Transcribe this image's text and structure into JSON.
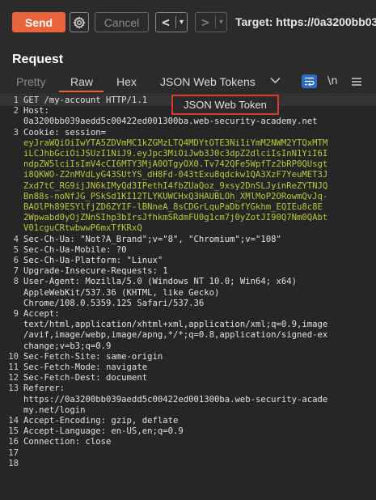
{
  "toolbar": {
    "send_label": "Send",
    "cancel_label": "Cancel",
    "back_arrow": "<",
    "forward_arrow": ">",
    "dropdown_arrow": "▾",
    "target_label": "Target: https://0a3200bb03"
  },
  "request": {
    "title": "Request",
    "tabs": [
      {
        "label": "Pretty"
      },
      {
        "label": "Raw"
      },
      {
        "label": "Hex"
      },
      {
        "label": "JSON Web Tokens"
      }
    ],
    "newline_icon_text": "\\n",
    "tooltip": "JSON Web Token"
  },
  "editor": {
    "lines": [
      {
        "n": "1",
        "text": "GET /my-account HTTP/1.1"
      },
      {
        "n": "2",
        "text": "Host:"
      },
      {
        "n": "",
        "text": "0a3200bb039aedd5c00422ed001300ba.web-security-academy.net"
      },
      {
        "n": "3",
        "text": "Cookie: session="
      },
      {
        "n": "",
        "text": "eyJraWQiOiIwYTA5ZDVmMC1kZGMzLTQ4MDYtOTE3Ni1iYmM2NWM2YTQxMTM",
        "cookie": true
      },
      {
        "n": "",
        "text": "iLCJhbGciOiJSUzI1NiJ9.eyJpc3MiOiJwb3J0c3dpZ2dlciIsInN1YiI6I",
        "cookie": true
      },
      {
        "n": "",
        "text": "ndpZW5lciIsImV4cCI6MTY3MjA0OTgyOX0.Tv742QFe5WpfTz2bRP0QUsgt",
        "cookie": true
      },
      {
        "n": "",
        "text": "i8QKWO-Z2nMVdLyG43SUtYS_dH8Fd-043tExu8qdckw1QA3XzF7YeuMET3J",
        "cookie": true
      },
      {
        "n": "",
        "text": "Zxd7tC_RG9ijJN6kIMyQd3IPethI4fbZUaQoz_9xsy2DnSLJyinReZYTNJQ",
        "cookie": true
      },
      {
        "n": "",
        "text": "Bn88s-noNfJG_PSkSd1KI12TLYKUWCHxQ3HAUBLOh_XMlMoP2ORowmQvJq-",
        "cookie": true
      },
      {
        "n": "",
        "text": "BAOlPh89ESYlfjZD6ZYIF-lBNneA_8sCDGrLquPaDbfYGkhm_EQIEu8c8E",
        "cookie": true
      },
      {
        "n": "",
        "text": "2Wpwabd0yOjZNnSIhp3bIrsJfhkmSRdmFU0g1cm7j0yZotJI90Q7Nm0QAbt",
        "cookie": true
      },
      {
        "n": "",
        "text": "V01cguCRtwbwwP6mxTfKRxQ",
        "cookie": true
      },
      {
        "n": "4",
        "text": "Sec-Ch-Ua: \"Not?A_Brand\";v=\"8\", \"Chromium\";v=\"108\""
      },
      {
        "n": "5",
        "text": "Sec-Ch-Ua-Mobile: ?0"
      },
      {
        "n": "6",
        "text": "Sec-Ch-Ua-Platform: \"Linux\""
      },
      {
        "n": "7",
        "text": "Upgrade-Insecure-Requests: 1"
      },
      {
        "n": "8",
        "text": "User-Agent: Mozilla/5.0 (Windows NT 10.0; Win64; x64)"
      },
      {
        "n": "",
        "text": "AppleWebKit/537.36 (KHTML, like Gecko)"
      },
      {
        "n": "",
        "text": "Chrome/108.0.5359.125 Safari/537.36"
      },
      {
        "n": "9",
        "text": "Accept:"
      },
      {
        "n": "",
        "text": "text/html,application/xhtml+xml,application/xml;q=0.9,image"
      },
      {
        "n": "",
        "text": "/avif,image/webp,image/apng,*/*;q=0.8,application/signed-ex"
      },
      {
        "n": "",
        "text": "change;v=b3;q=0.9"
      },
      {
        "n": "10",
        "text": "Sec-Fetch-Site: same-origin"
      },
      {
        "n": "11",
        "text": "Sec-Fetch-Mode: navigate"
      },
      {
        "n": "12",
        "text": "Sec-Fetch-Dest: document"
      },
      {
        "n": "13",
        "text": "Referer:"
      },
      {
        "n": "",
        "text": "https://0a3200bb039aedd5c00422ed001300ba.web-security-acade"
      },
      {
        "n": "",
        "text": "my.net/login"
      },
      {
        "n": "14",
        "text": "Accept-Encoding: gzip, deflate"
      },
      {
        "n": "15",
        "text": "Accept-Language: en-US,en;q=0.9"
      },
      {
        "n": "16",
        "text": "Connection: close"
      },
      {
        "n": "17",
        "text": ""
      },
      {
        "n": "18",
        "text": ""
      }
    ]
  }
}
